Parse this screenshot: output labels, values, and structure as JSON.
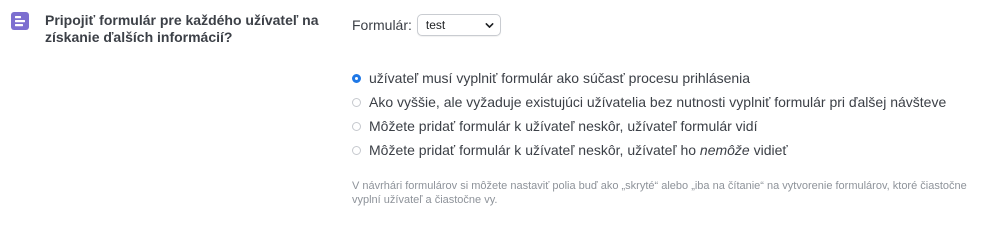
{
  "setting": {
    "icon": "form-icon",
    "icon_color": "#7c6fd0",
    "title": "Pripojiť formulár pre každého užívateľ na získanie ďalších informácií?"
  },
  "form_select": {
    "label": "Formulár:",
    "value": "test"
  },
  "options": [
    {
      "label": "užívateľ musí vyplniť formulár ako súčasť procesu prihlásenia",
      "selected": true
    },
    {
      "label": "Ako vyššie, ale vyžaduje existujúci užívatelia bez nutnosti vyplniť formulár pri ďalšej návšteve",
      "selected": false
    },
    {
      "label": "Môžete pridať formulár k užívateľ neskôr, užívateľ formulár vidí",
      "selected": false
    },
    {
      "label_prefix": "Môžete pridať formulár k užívateľ neskôr, užívateľ ho ",
      "label_emphasis": "nemôže",
      "label_suffix": " vidieť",
      "selected": false
    }
  ],
  "help_text": "V návrhári formulárov si môžete nastaviť polia buď ako „skryté“ alebo „iba na čítanie“ na vytvorenie formulárov, ktoré čiastočne vyplní užívateľ a čiastočne vy.",
  "colors": {
    "accent": "#1f78e6",
    "muted_text": "#8e939a"
  }
}
